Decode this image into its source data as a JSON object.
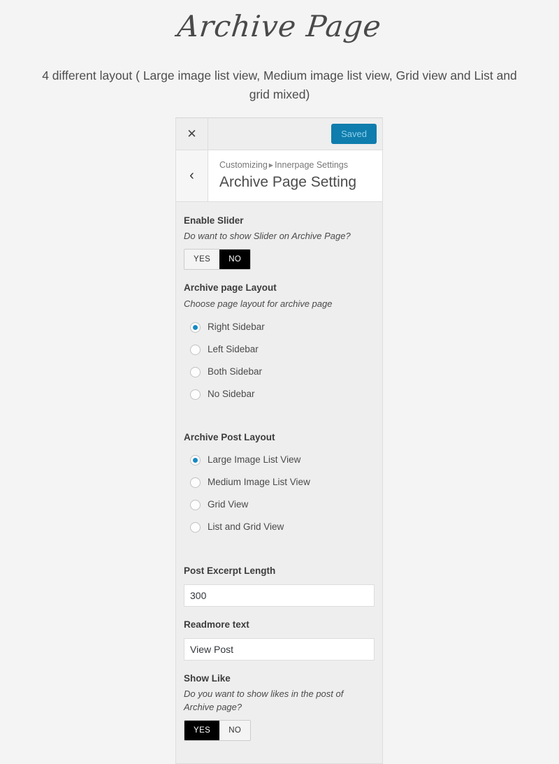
{
  "page": {
    "title": "Archive Page",
    "subtitle": "4 different layout ( Large image list view, Medium image list view, Grid view and List and grid mixed)"
  },
  "customizer": {
    "topbar": {
      "close_icon": "close-icon",
      "save_label": "Saved"
    },
    "header": {
      "back_icon": "chevron-left-icon",
      "breadcrumb_root": "Customizing",
      "breadcrumb_separator": "▸",
      "breadcrumb_current": "Innerpage Settings",
      "panel_title": "Archive Page Setting"
    },
    "controls": {
      "enable_slider": {
        "title": "Enable Slider",
        "description": "Do want to show Slider on Archive Page?",
        "options": [
          "YES",
          "NO"
        ],
        "selected": "NO"
      },
      "archive_page_layout": {
        "title": "Archive page Layout",
        "description": "Choose page layout for archive page",
        "options": [
          "Right Sidebar",
          "Left Sidebar",
          "Both Sidebar",
          "No Sidebar"
        ],
        "selected": "Right Sidebar"
      },
      "archive_post_layout": {
        "title": "Archive Post Layout",
        "options": [
          "Large Image List View",
          "Medium Image List View",
          "Grid View",
          "List and Grid View"
        ],
        "selected": "Large Image List View"
      },
      "post_excerpt_length": {
        "title": "Post Excerpt Length",
        "value": "300"
      },
      "readmore_text": {
        "title": "Readmore text",
        "value": "View Post"
      },
      "show_like": {
        "title": "Show Like",
        "description": "Do you want to show likes in the post of Archive page?",
        "options": [
          "YES",
          "NO"
        ],
        "selected": "YES"
      }
    }
  },
  "colors": {
    "save_button_bg": "#0f7dad",
    "save_button_text": "#8fd0ea",
    "radio_selected": "#1789c4",
    "toggle_on_bg": "#000000",
    "panel_bg": "#eeeeee",
    "page_bg": "#f4f4f4"
  }
}
